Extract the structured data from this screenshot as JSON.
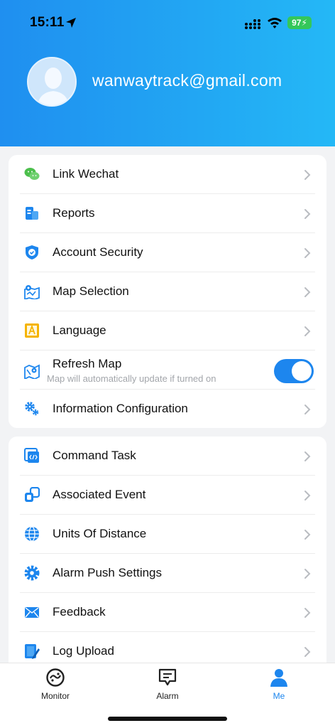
{
  "status": {
    "time": "15:11",
    "battery": "97"
  },
  "profile": {
    "email": "wanwaytrack@gmail.com"
  },
  "menu_group1": [
    {
      "label": "Link Wechat",
      "icon": "wechat-icon"
    },
    {
      "label": "Reports",
      "icon": "reports-icon"
    },
    {
      "label": "Account Security",
      "icon": "shield-icon"
    },
    {
      "label": "Map Selection",
      "icon": "map-icon"
    },
    {
      "label": "Language",
      "icon": "language-icon"
    },
    {
      "label": "Refresh Map",
      "icon": "refresh-map-icon",
      "subtitle": "Map will automatically update if turned on",
      "toggle_on": true
    },
    {
      "label": "Information Configuration",
      "icon": "gear-icon"
    }
  ],
  "menu_group2": [
    {
      "label": "Command Task",
      "icon": "command-icon"
    },
    {
      "label": "Associated Event",
      "icon": "link-icon"
    },
    {
      "label": "Units Of Distance",
      "icon": "globe-icon"
    },
    {
      "label": "Alarm Push Settings",
      "icon": "gear-icon"
    },
    {
      "label": "Feedback",
      "icon": "mail-icon"
    },
    {
      "label": "Log Upload",
      "icon": "log-icon"
    }
  ],
  "tabs": [
    {
      "label": "Monitor",
      "icon": "monitor-icon"
    },
    {
      "label": "Alarm",
      "icon": "alarm-icon"
    },
    {
      "label": "Me",
      "icon": "person-icon",
      "active": true
    }
  ],
  "colors": {
    "accent": "#1d86ee",
    "header_start": "#1f8ff0",
    "header_end": "#24b8f6",
    "wechat": "#4cbf4c",
    "language": "#f5b400"
  }
}
